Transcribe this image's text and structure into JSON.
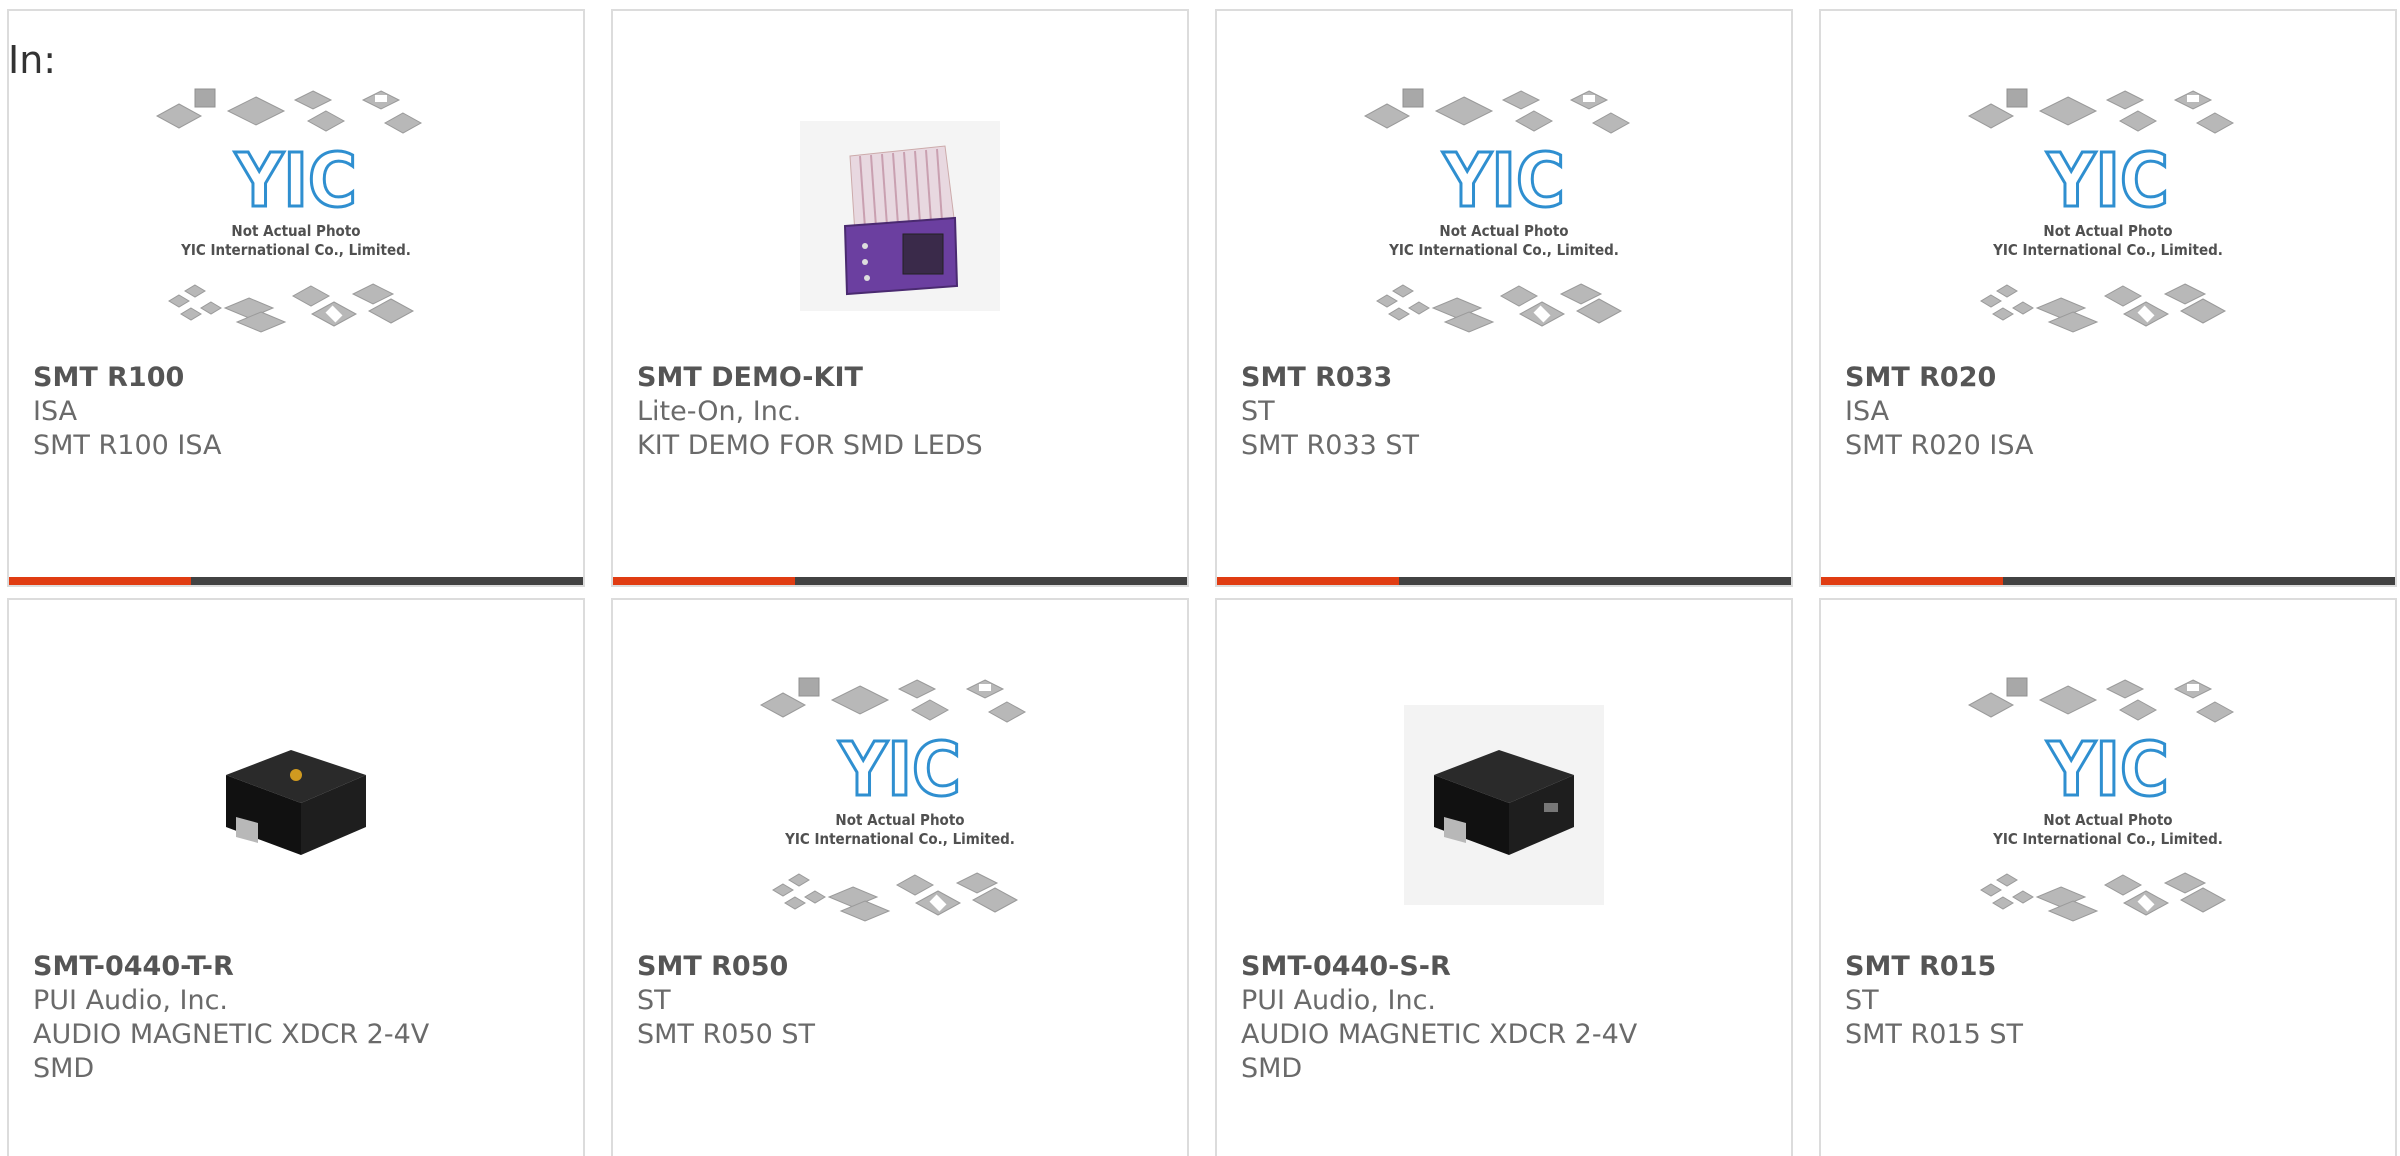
{
  "page": {
    "in_label": "In:"
  },
  "colors": {
    "accent": "#e03c12",
    "bar": "#424242",
    "logo_blue": "#2f8fd0",
    "chip_gray": "#b8b8b8"
  },
  "placeholder": {
    "line1": "Not Actual Photo",
    "line2": "YIC International Co., Limited."
  },
  "products": [
    {
      "part": "SMT R100",
      "maker": "ISA",
      "desc1": "SMT R100 ISA",
      "desc2": "",
      "image": "placeholder-logo"
    },
    {
      "part": "SMT DEMO-KIT",
      "maker": "Lite-On, Inc.",
      "desc1": "KIT DEMO FOR SMD LEDS",
      "desc2": "",
      "image": "purple-kit-photo"
    },
    {
      "part": "SMT R033",
      "maker": "ST",
      "desc1": "SMT R033 ST",
      "desc2": "",
      "image": "placeholder-logo"
    },
    {
      "part": "SMT R020",
      "maker": "ISA",
      "desc1": "SMT R020 ISA",
      "desc2": "",
      "image": "placeholder-logo"
    },
    {
      "part": "SMT-0440-T-R",
      "maker": "PUI Audio, Inc.",
      "desc1": "AUDIO MAGNETIC XDCR 2-4V",
      "desc2": "SMD",
      "image": "black-buzzer-top-port"
    },
    {
      "part": "SMT R050",
      "maker": "ST",
      "desc1": "SMT R050 ST",
      "desc2": "",
      "image": "placeholder-logo"
    },
    {
      "part": "SMT-0440-S-R",
      "maker": "PUI Audio, Inc.",
      "desc1": "AUDIO MAGNETIC XDCR 2-4V",
      "desc2": "SMD",
      "image": "black-buzzer-side-port"
    },
    {
      "part": "SMT R015",
      "maker": "ST",
      "desc1": "SMT R015 ST",
      "desc2": "",
      "image": "placeholder-logo"
    }
  ]
}
